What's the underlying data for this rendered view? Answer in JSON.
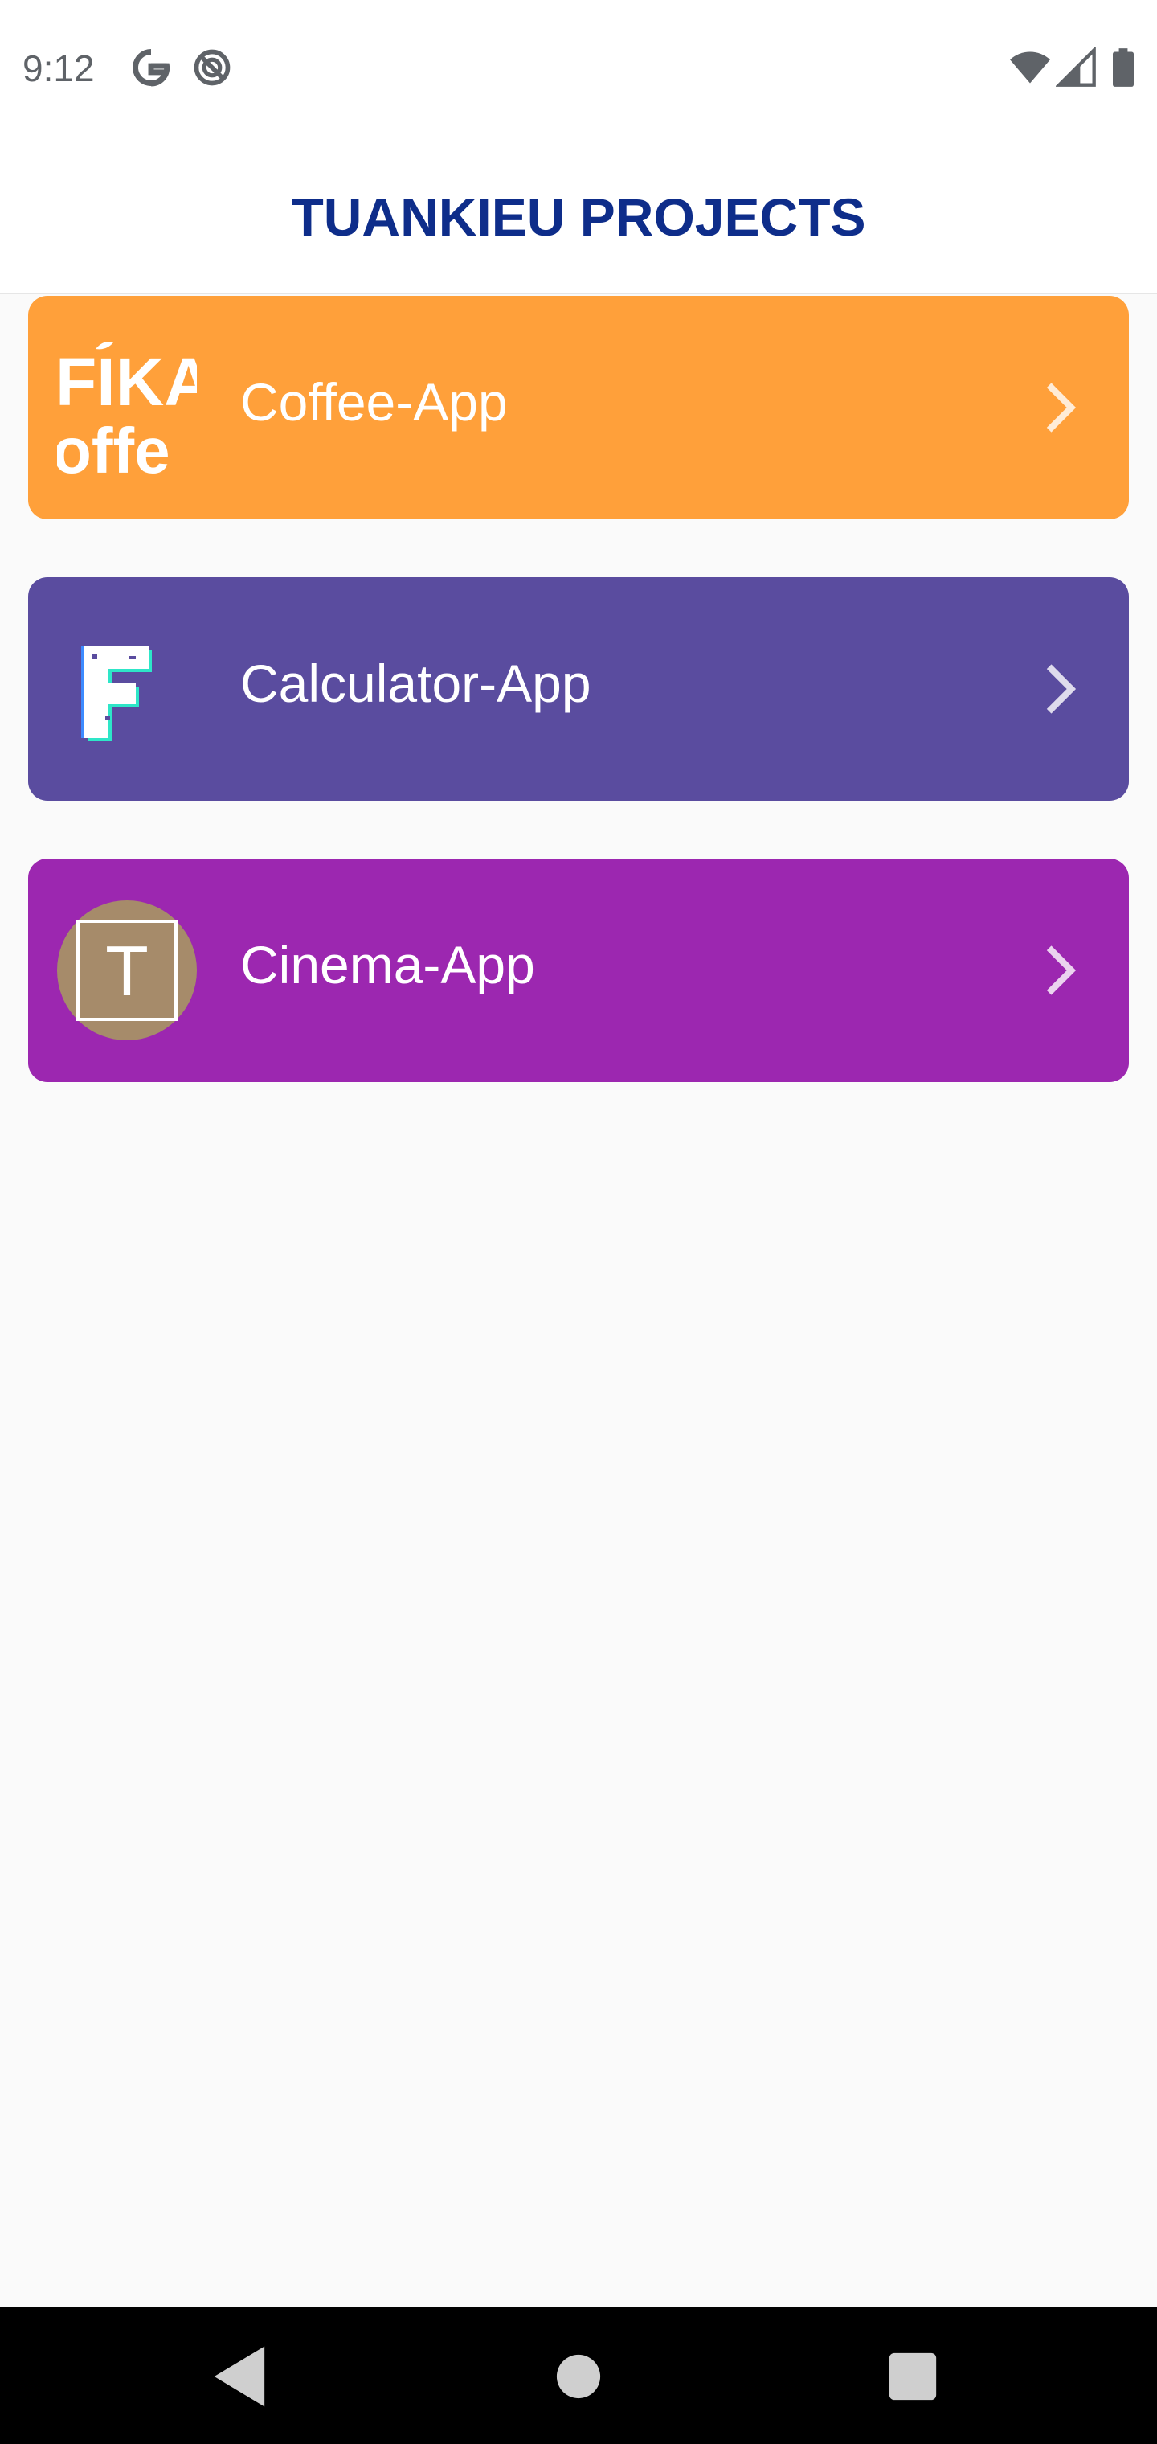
{
  "status_bar": {
    "time": "9:12",
    "left_icons": [
      "google-g-icon",
      "do-not-disturb-icon"
    ],
    "right_icons": [
      "wifi-icon",
      "cell-signal-icon",
      "battery-icon"
    ]
  },
  "app_bar": {
    "title": "TUANKIEU PROJECTS"
  },
  "projects": [
    {
      "label": "Coffee-App",
      "color": "#FFA03A",
      "icon": "fika-coffee-logo-icon",
      "icon_text_1": "FIKA",
      "icon_text_2": "offe"
    },
    {
      "label": "Calculator-App",
      "color": "#5A4C9F",
      "icon": "pixel-f-logo-icon"
    },
    {
      "label": "Cinema-App",
      "color": "#9C27B0",
      "icon": "t-avatar-icon",
      "icon_text": "T"
    }
  ],
  "nav_bar": {
    "buttons": [
      "back-icon",
      "home-icon",
      "recents-icon"
    ]
  },
  "colors": {
    "title": "#0E2D8A",
    "background": "#FAFAFA",
    "nav_bar": "#000000",
    "avatar": "#A68B6A"
  }
}
